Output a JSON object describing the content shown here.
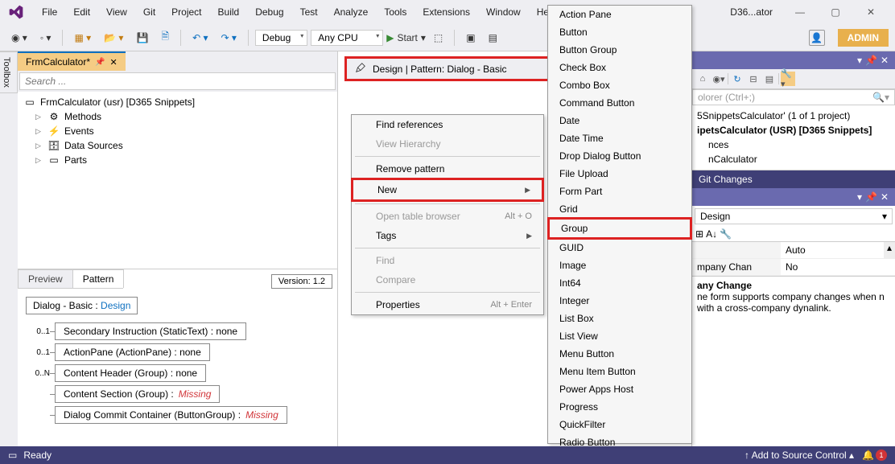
{
  "menu": {
    "items": [
      "File",
      "Edit",
      "View",
      "Git",
      "Project",
      "Build",
      "Debug",
      "Test",
      "Analyze",
      "Tools",
      "Extensions",
      "Window",
      "Help"
    ]
  },
  "window_title": "D36...ator",
  "admin_label": "ADMIN",
  "toolbar": {
    "config": "Debug",
    "platform": "Any CPU",
    "run_label": "Start"
  },
  "toolbox_label": "Toolbox",
  "doc_tab": {
    "title": "FrmCalculator*"
  },
  "search_placeholder": "Search ...",
  "tree": {
    "root": "FrmCalculator (usr) [D365 Snippets]",
    "children": [
      "Methods",
      "Events",
      "Data Sources",
      "Parts"
    ]
  },
  "pattern_panel": {
    "tabs": [
      "Preview",
      "Pattern"
    ],
    "version": "Version:  1.2",
    "header_prefix": "Dialog - Basic",
    "header_link": "Design",
    "rows": [
      {
        "mult": "0..1",
        "label": "Secondary Instruction  (StaticText)  :   none"
      },
      {
        "mult": "0..1",
        "label": "ActionPane  (ActionPane)  :   none"
      },
      {
        "mult": "0..N",
        "label": "Content Header  (Group)  :   none"
      },
      {
        "mult": "",
        "label": "Content Section  (Group)  :",
        "missing": "Missing"
      },
      {
        "mult": "",
        "label": "Dialog Commit Container  (ButtonGroup)  :",
        "missing": "Missing"
      }
    ]
  },
  "design_header": "Design | Pattern: Dialog - Basic",
  "context_menu": [
    {
      "label": "Find references",
      "type": "item"
    },
    {
      "label": "View Hierarchy",
      "type": "item",
      "disabled": true
    },
    {
      "type": "sep"
    },
    {
      "label": "Remove pattern",
      "type": "item"
    },
    {
      "label": "New",
      "type": "submenu",
      "highlighted": true
    },
    {
      "type": "sep"
    },
    {
      "label": "Open table browser",
      "type": "item",
      "disabled": true,
      "shortcut": "Alt + O"
    },
    {
      "label": "Tags",
      "type": "submenu"
    },
    {
      "type": "sep"
    },
    {
      "label": "Find",
      "type": "item",
      "disabled": true
    },
    {
      "label": "Compare",
      "type": "item",
      "disabled": true
    },
    {
      "type": "sep"
    },
    {
      "label": "Properties",
      "type": "item",
      "shortcut": "Alt + Enter"
    }
  ],
  "submenu_items": [
    "Action Pane",
    "Button",
    "Button Group",
    "Check Box",
    "Combo Box",
    "Command Button",
    "Date",
    "Date Time",
    "Drop Dialog Button",
    "File Upload",
    "Form Part",
    "Grid",
    "Group",
    "GUID",
    "Image",
    "Int64",
    "Integer",
    "List Box",
    "List View",
    "Menu Button",
    "Menu Item Button",
    "Power Apps Host",
    "Progress",
    "QuickFilter",
    "Radio Button"
  ],
  "submenu_highlight": "Group",
  "solution_explorer": {
    "toolbar_search_placeholder": "olorer (Ctrl+;)",
    "line1": "5SnippetsCalculator' (1 of 1 project)",
    "line2": "ipetsCalculator (USR) [D365 Snippets]",
    "line3": "nces",
    "line4": "nCalculator"
  },
  "git_changes_label": "Git Changes",
  "properties": {
    "dropdown": "Design",
    "rows": [
      {
        "key": "",
        "val": "Auto"
      },
      {
        "key": "mpany Chan",
        "val": "No"
      }
    ],
    "desc_title": "any Change",
    "desc_body": "ne form supports company changes when n with a cross-company dynalink."
  },
  "statusbar": {
    "ready": "Ready",
    "source_control": "Add to Source Control",
    "notifications": "1"
  }
}
